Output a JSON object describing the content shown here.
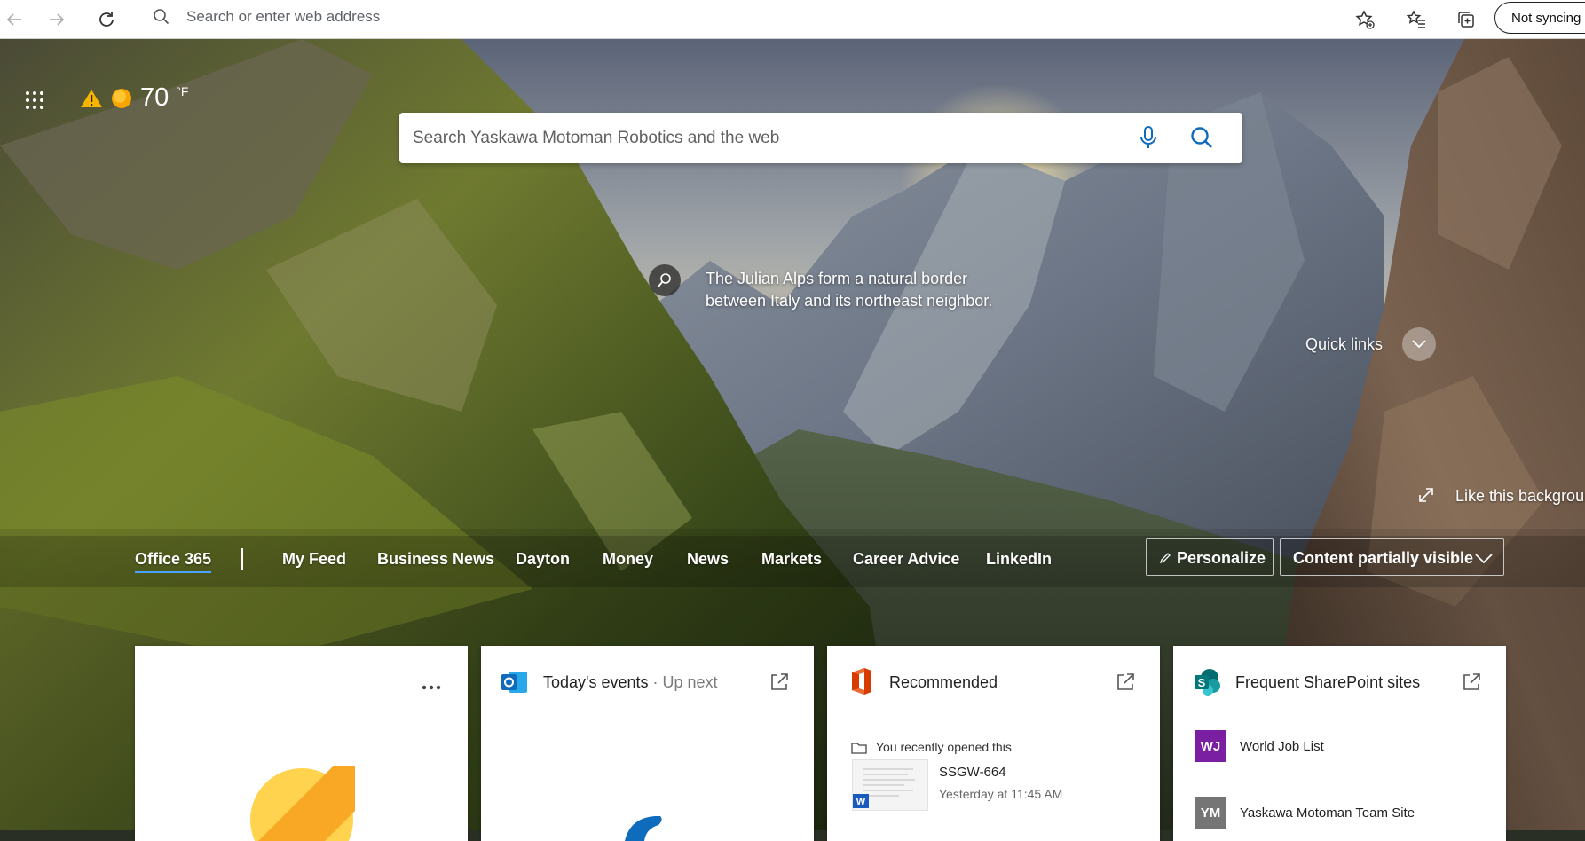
{
  "browser": {
    "address_placeholder": "Search or enter web address",
    "sync_label": "Not syncing"
  },
  "weather": {
    "temperature": "70",
    "unit": "°F",
    "alert_icon": "warning-icon",
    "condition_icon": "sun-icon"
  },
  "search": {
    "placeholder": "Search Yaskawa Motoman Robotics and the web"
  },
  "background": {
    "caption": "The Julian Alps form a natural border between Italy and its northeast neighbor.",
    "like_label": "Like this background?"
  },
  "quick_links": {
    "label": "Quick links"
  },
  "nav": {
    "tabs": [
      "Office 365",
      "My Feed",
      "Business News",
      "Dayton",
      "Money",
      "News",
      "Markets",
      "Career Advice",
      "LinkedIn"
    ],
    "active_tab": "Office 365",
    "personalize_label": "Personalize",
    "content_visibility_label": "Content partially visible"
  },
  "cards": {
    "events": {
      "title": "Today's events",
      "separator": " · ",
      "subtitle": "Up next"
    },
    "recommended": {
      "title": "Recommended",
      "section_label": "You recently opened this",
      "doc_name": "SSGW-664",
      "doc_time": "Yesterday at 11:45 AM"
    },
    "sharepoint": {
      "title": "Frequent SharePoint sites",
      "sites": [
        {
          "initials": "WJ",
          "name": "World Job List",
          "color": "#7b1fa2"
        },
        {
          "initials": "YM",
          "name": "Yaskawa Motoman Team Site",
          "color": "#757575"
        }
      ]
    }
  },
  "colors": {
    "accent": "#4aa3ff",
    "outlook_blue": "#0f6cbd",
    "office_orange": "#d83b01",
    "sharepoint_teal": "#03787c"
  }
}
